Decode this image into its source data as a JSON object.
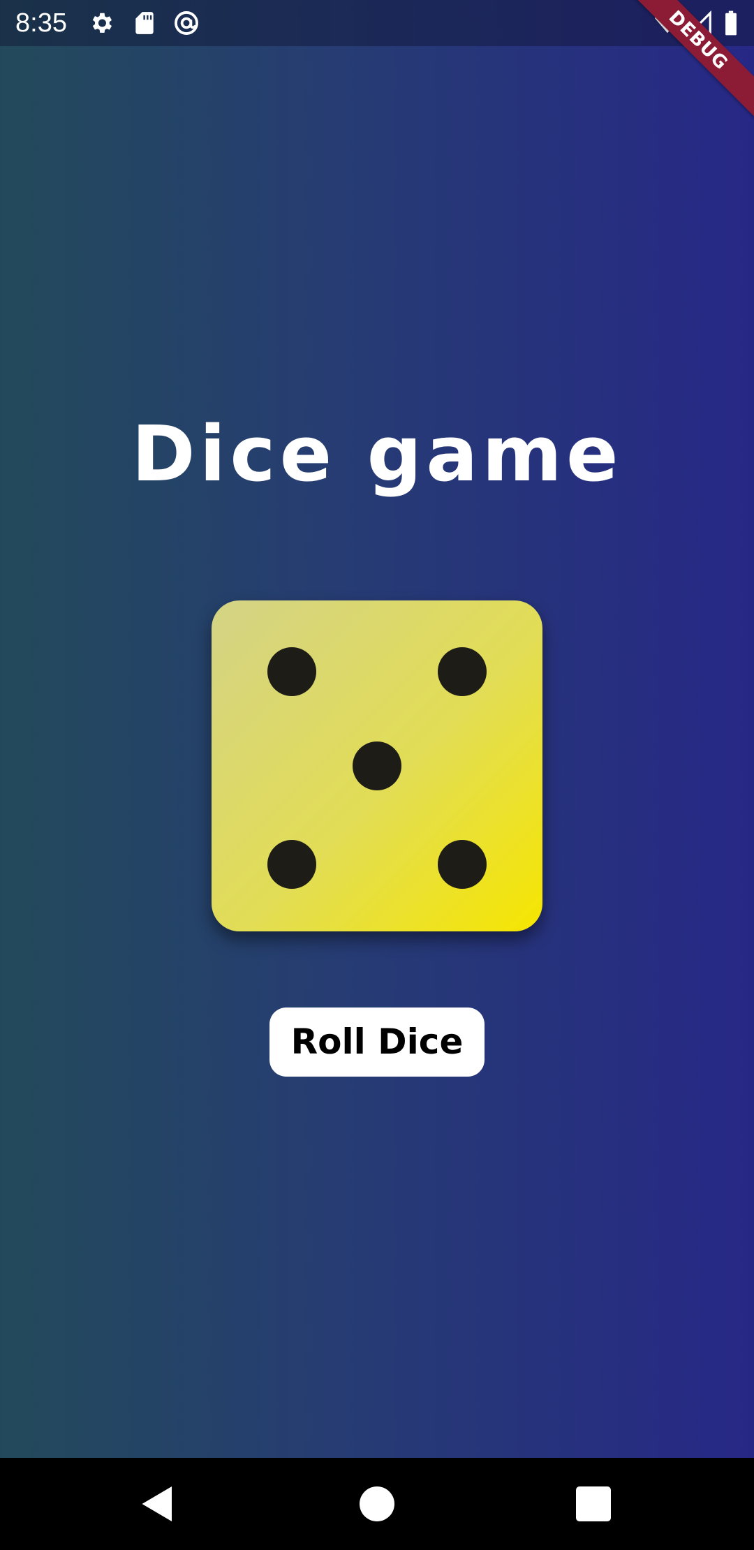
{
  "status_bar": {
    "time": "8:35",
    "left_icons": [
      "gear-icon",
      "sd-card-icon",
      "at-sign-icon"
    ],
    "right_icons": [
      "wifi-icon",
      "signal-icon",
      "battery-icon"
    ]
  },
  "debug_banner": {
    "label": "DEBUG",
    "color": "#8c1c36"
  },
  "app": {
    "title": "Dice game",
    "dice": {
      "value": 5,
      "color_start": "#d4d386",
      "color_end": "#f6e600",
      "pip_color": "#1e1c16"
    },
    "roll_button_label": "Roll Dice"
  },
  "background": {
    "gradient_start": "#234a5b",
    "gradient_end": "#272886"
  },
  "nav_bar": {
    "buttons": [
      "back-icon",
      "home-icon",
      "recents-icon"
    ]
  }
}
